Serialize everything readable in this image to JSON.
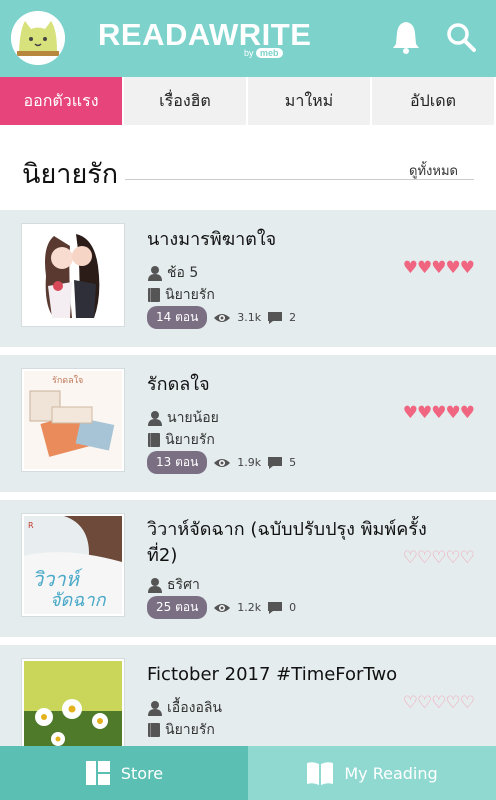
{
  "header": {
    "logo_text": "READAWRITE",
    "byline_prefix": "by",
    "byline_brand": "meb"
  },
  "tabs": [
    {
      "label": "ออกตัวแรง",
      "active": true
    },
    {
      "label": "เรื่องฮิต",
      "active": false
    },
    {
      "label": "มาใหม่",
      "active": false
    },
    {
      "label": "อัปเดต",
      "active": false
    }
  ],
  "section": {
    "title": "นิยายรัก",
    "see_all": "ดูทั้งหมด"
  },
  "books": [
    {
      "title": "นางมารพิฆาตใจ",
      "author": "ช้อ 5",
      "category": "นิยายรัก",
      "episodes": "14 ตอน",
      "views": "3.1k",
      "comments": "2",
      "rating": 5
    },
    {
      "title": "รักดลใจ",
      "author": "นายน้อย",
      "category": "นิยายรัก",
      "episodes": "13 ตอน",
      "views": "1.9k",
      "comments": "5",
      "rating": 5
    },
    {
      "title": "วิวาห์จัดฉาก (ฉบับปรับปรุง พิมพ์ครั้งที่2)",
      "author": "ธริศา",
      "category": "",
      "episodes": "25 ตอน",
      "views": "1.2k",
      "comments": "0",
      "rating": 0
    },
    {
      "title": "Fictober 2017 #TimeForTwo",
      "author": "เอื้องอลิน",
      "category": "นิยายรัก",
      "episodes": "",
      "views": "",
      "comments": "",
      "rating": 0
    }
  ],
  "bottom_nav": {
    "store_label": "Store",
    "reading_label": "My Reading"
  },
  "colors": {
    "header": "#7dd3cc",
    "active_tab": "#e6447a",
    "heart": "#f0657f",
    "pill": "#7a6f83"
  }
}
